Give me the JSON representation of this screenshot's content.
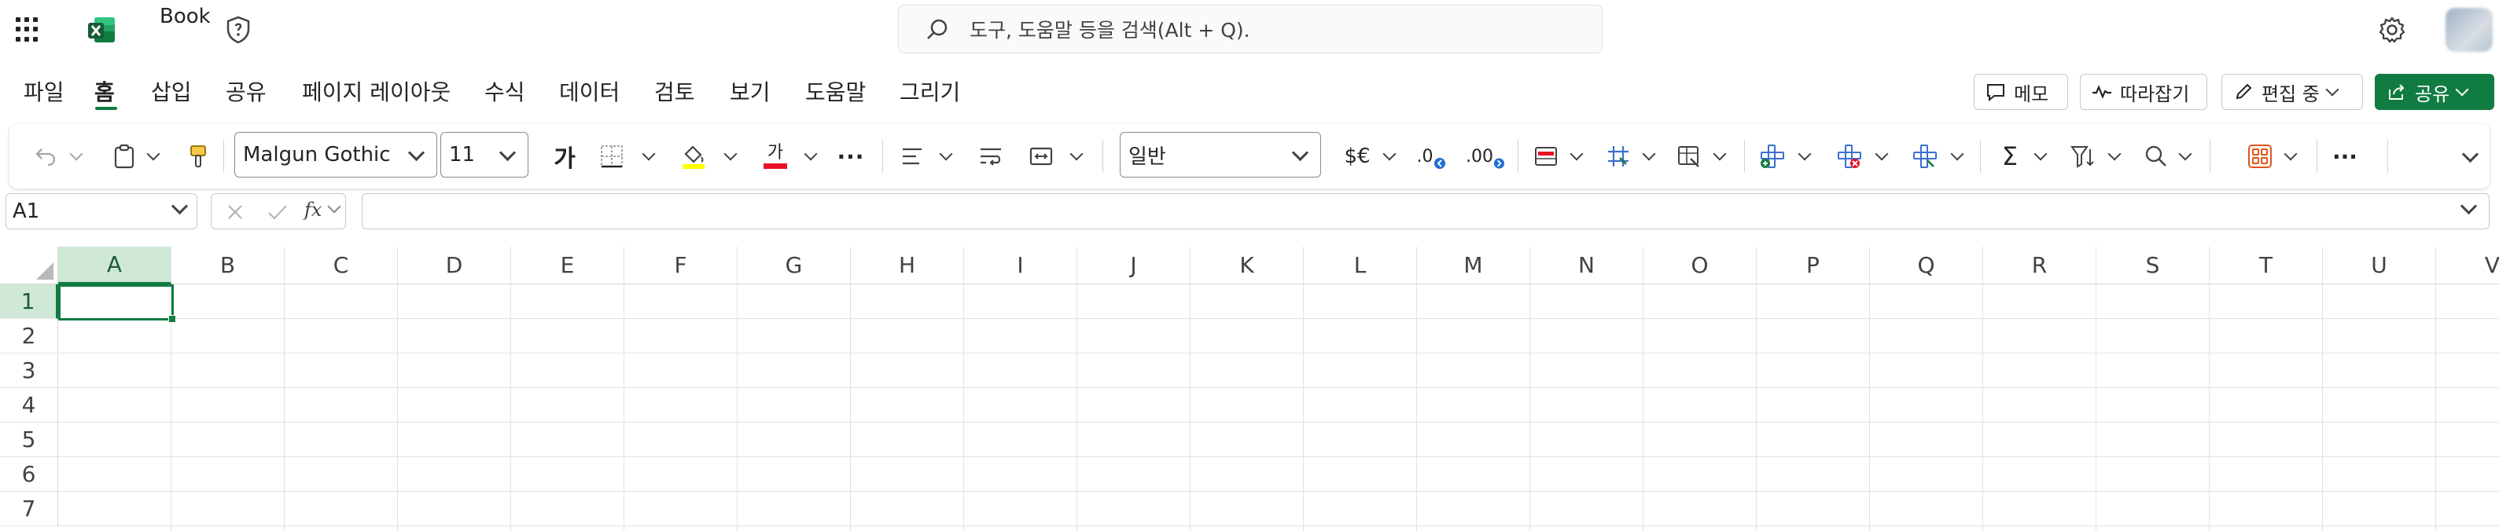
{
  "app": {
    "doc_title": "Book",
    "brand_color": "#107c41"
  },
  "search": {
    "placeholder": "도구, 도움말 등을 검색(Alt + Q)."
  },
  "menu": {
    "tabs": [
      "파일",
      "홈",
      "삽입",
      "공유",
      "페이지 레이아웃",
      "수식",
      "데이터",
      "검토",
      "보기",
      "도움말",
      "그리기"
    ],
    "active_tab": "홈"
  },
  "actions": {
    "comments": "메모",
    "catch_up": "따라잡기",
    "editing": "편집 중",
    "share": "공유"
  },
  "ribbon": {
    "font_name": "Malgun Gothic",
    "font_size": "11",
    "bold_glyph": "가",
    "font_color_glyph": "가",
    "number_format": "일반",
    "currency_glyph": "$€",
    "dec_decrease_glyph": ".0",
    "dec_increase_glyph": ".00",
    "more_glyph": "···",
    "sum_glyph": "Σ"
  },
  "formula_bar": {
    "name_box": "A1",
    "fx_label": "fx",
    "formula": ""
  },
  "grid": {
    "columns": [
      "A",
      "B",
      "C",
      "D",
      "E",
      "F",
      "G",
      "H",
      "I",
      "J",
      "K",
      "L",
      "M",
      "N",
      "O",
      "P",
      "Q",
      "R",
      "S",
      "T",
      "U",
      "V"
    ],
    "rows": [
      "1",
      "2",
      "3",
      "4",
      "5",
      "6",
      "7"
    ],
    "active_cell": "A1"
  }
}
